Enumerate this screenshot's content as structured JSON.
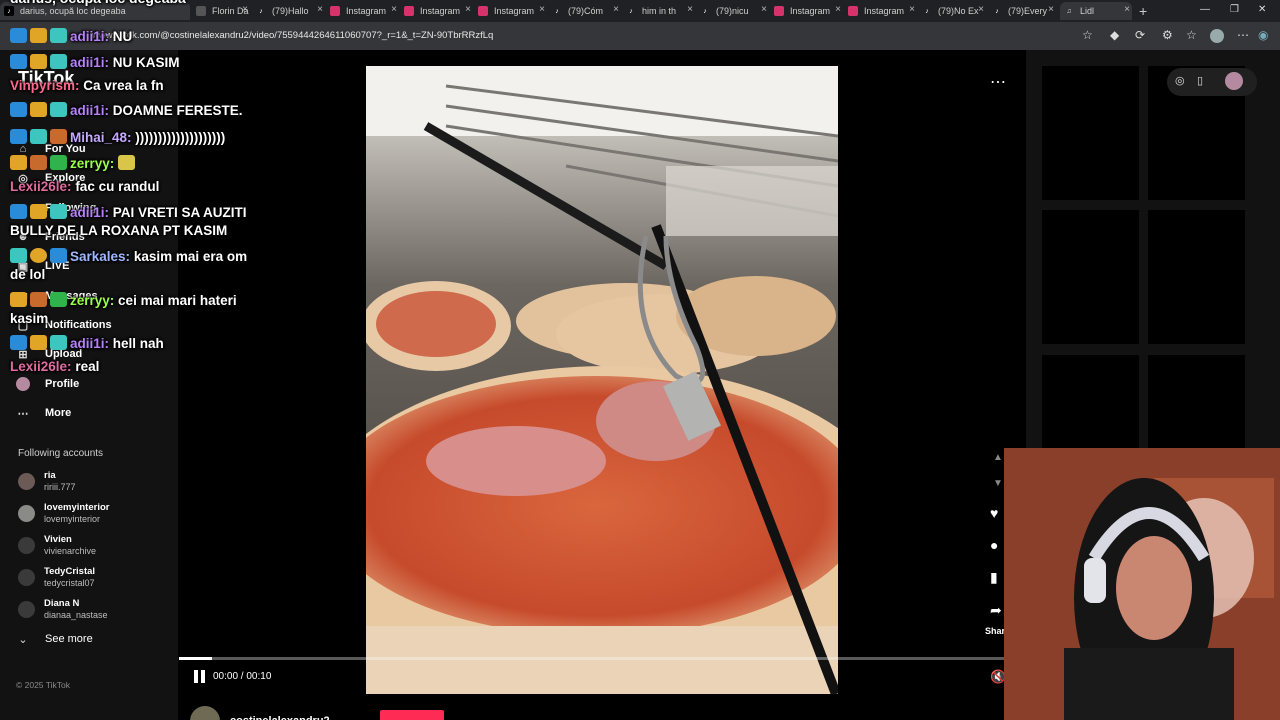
{
  "browser": {
    "tabs": [
      {
        "label": "darius, ocupă loc degeaba",
        "icon": "tiktok-icon"
      },
      {
        "label": "Florin Da",
        "icon": "web-icon"
      },
      {
        "label": "(79)Hallo",
        "icon": "tiktok-icon"
      },
      {
        "label": "Instagram",
        "icon": "instagram-icon"
      },
      {
        "label": "Instagram",
        "icon": "instagram-icon"
      },
      {
        "label": "Instagram",
        "icon": "instagram-icon"
      },
      {
        "label": "(79)Cóm",
        "icon": "tiktok-icon"
      },
      {
        "label": "him in th",
        "icon": "tiktok-icon"
      },
      {
        "label": "(79)nicu",
        "icon": "tiktok-icon"
      },
      {
        "label": "Instagram",
        "icon": "instagram-icon"
      },
      {
        "label": "Instagram",
        "icon": "instagram-icon"
      },
      {
        "label": "(79)No Ex",
        "icon": "tiktok-icon"
      },
      {
        "label": "(79)Every",
        "icon": "tiktok-icon"
      },
      {
        "label": "Lidl",
        "icon": "speaker-icon"
      }
    ],
    "url": "www.tiktok.com/@costinelalexandru2/video/7559444264611060707?_r=1&_t=ZN-90TbrRRzfLq"
  },
  "tiktok": {
    "logo": "TikTok",
    "nav": [
      {
        "label": "For You",
        "icon": "home-icon"
      },
      {
        "label": "Explore",
        "icon": "compass-icon"
      },
      {
        "label": "Following",
        "icon": "following-icon"
      },
      {
        "label": "Friends",
        "icon": "friends-icon"
      },
      {
        "label": "LIVE",
        "icon": "live-icon"
      },
      {
        "label": "Messages",
        "icon": "messages-icon"
      },
      {
        "label": "Notifications",
        "icon": "bell-icon"
      },
      {
        "label": "Upload",
        "icon": "upload-icon"
      },
      {
        "label": "Profile",
        "icon": "profile-icon"
      },
      {
        "label": "More",
        "icon": "more-icon"
      }
    ],
    "following_header": "Following accounts",
    "accounts": [
      {
        "name": "ria",
        "handle": "ririii.777"
      },
      {
        "name": "lovemyinterior",
        "handle": "lovemyinterior"
      },
      {
        "name": "Vivien",
        "handle": "vivienarchive"
      },
      {
        "name": "TedyCristal",
        "handle": "tedycristal07"
      },
      {
        "name": "Diana N",
        "handle": "dianaa_nastase"
      }
    ],
    "see_more": "See more",
    "copyright": "© 2025 TikTok",
    "player": {
      "time": "00:00 / 00:10",
      "progress": 0.04,
      "author": "costinelalexandru2",
      "share_label": "Share"
    }
  },
  "chat": [
    {
      "user": "",
      "text": "NU",
      "badges": [
        "b-blue",
        "b-gold",
        "b-teal"
      ]
    },
    {
      "user": "adii1i:",
      "text": "NU KASIM",
      "color": "u-purple",
      "badges": [
        "b-blue",
        "b-gold",
        "b-teal"
      ]
    },
    {
      "user": "Vinpyrism:",
      "text": "Ca vrea la fn",
      "color": "u-pink",
      "badges": []
    },
    {
      "user": "adii1i:",
      "text": "DOAMNE FERESTE.",
      "color": "u-purple",
      "badges": [
        "b-blue",
        "b-gold",
        "b-teal"
      ]
    },
    {
      "user": "Mihai_48:",
      "text": "))))))))))))))))))))",
      "color": "u-lav",
      "badges": [
        "b-blue",
        "b-teal",
        "b-orange"
      ]
    },
    {
      "user": "zerryy:",
      "text": "",
      "color": "u-lime",
      "badges": [
        "b-gold",
        "b-orange",
        "b-green"
      ]
    },
    {
      "user": "Lexii26le:",
      "text": "fac cu randul",
      "color": "u-pink2",
      "badges": []
    },
    {
      "user": "adii1i:",
      "text": "PAI VRETI SA AUZITI BULLY DE LA ROXANA PT KASIM",
      "color": "u-purple",
      "badges": [
        "b-blue",
        "b-gold",
        "b-teal"
      ]
    },
    {
      "user": "Sarkales:",
      "text": "kasim mai era om de lol",
      "color": "u-blue2",
      "badges": [
        "b-teal",
        "b-gold",
        "b-blue"
      ]
    },
    {
      "user": "zerryy:",
      "text": "cei mai mari hateri kasim",
      "color": "u-lime",
      "badges": [
        "b-gold",
        "b-orange",
        "b-green"
      ]
    },
    {
      "user": "adii1i:",
      "text": "hell nah",
      "color": "u-purple",
      "badges": [
        "b-blue",
        "b-gold",
        "b-teal"
      ]
    },
    {
      "user": "Lexii26le:",
      "text": "real",
      "color": "u-pink2",
      "badges": []
    }
  ]
}
